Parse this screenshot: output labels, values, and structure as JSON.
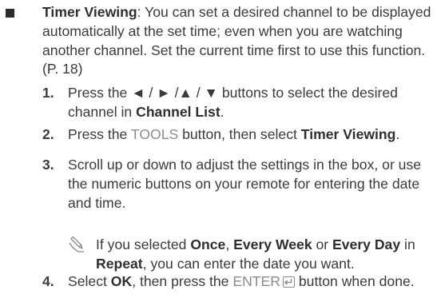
{
  "intro": {
    "title": "Timer Viewing",
    "body": ": You can set a desired channel to be displayed automatically at the set time; even when you are watching another channel. Set the current time first to use this function. (P. 18)"
  },
  "steps": [
    {
      "num": "1.",
      "pre": "Press the ◄ / ► /▲ / ▼ buttons to select the desired channel in ",
      "bold": "Channel List",
      "post": "."
    },
    {
      "num": "2.",
      "pre": "Press the ",
      "gray": "TOOLS",
      "mid": " button, then select ",
      "bold": "Timer Viewing",
      "post": "."
    },
    {
      "num": "3.",
      "text": "Scroll up or down to adjust the settings in the box, or use the numeric buttons on your remote for entering the date and time."
    },
    {
      "num": "4.",
      "pre": "Select ",
      "bold": "OK",
      "mid": ", then press the ",
      "gray": "ENTER",
      "post": " button when done."
    }
  ],
  "note": {
    "icon": "pencil-note-icon",
    "pre": "If you selected ",
    "once": "Once",
    "sep1": ", ",
    "every_week": "Every Week",
    "sep2": " or ",
    "every_day": "Every Day",
    "mid": " in ",
    "repeat": "Repeat",
    "post": ", you can enter the date you want."
  }
}
